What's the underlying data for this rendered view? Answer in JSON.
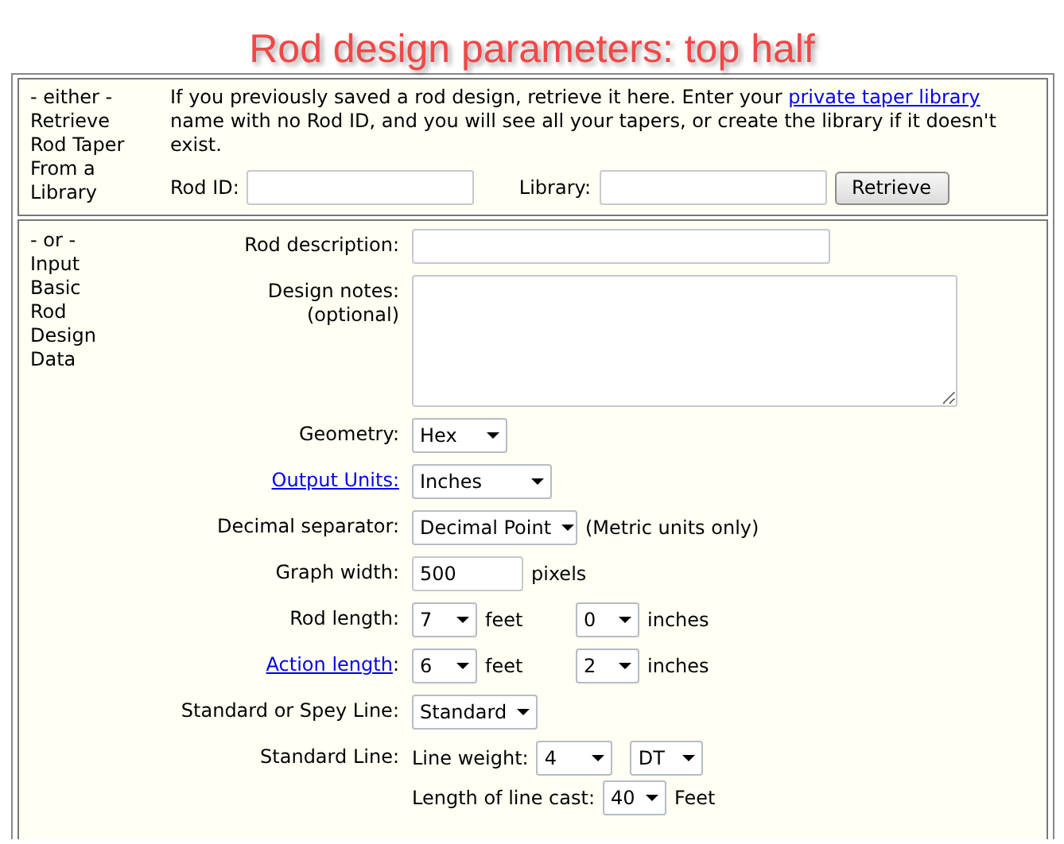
{
  "title": "Rod design parameters: top half",
  "retrieve": {
    "side_label": "- either -\nRetrieve\nRod Taper\nFrom a\nLibrary",
    "intro_before": "If you previously saved a rod design, retrieve it here. Enter your ",
    "intro_link": "private taper library",
    "intro_after": " name with no Rod ID, and you will see all your tapers, or create the library if it doesn't exist.",
    "rod_id_label": "Rod ID:",
    "library_label": "Library:",
    "button": "Retrieve"
  },
  "design": {
    "side_label": "- or -\nInput\nBasic\nRod\nDesign\nData",
    "rows": [
      {
        "label": "Rod description:",
        "link": false,
        "lines": [
          [
            {
              "kind": "input"
            }
          ]
        ]
      },
      {
        "label": "Design notes:\n(optional)",
        "link": false,
        "lines": [
          [
            {
              "kind": "textarea"
            }
          ]
        ]
      },
      {
        "label": "Geometry:",
        "link": false,
        "lines": [
          [
            {
              "kind": "select",
              "value": "Hex"
            }
          ]
        ]
      },
      {
        "label": "Output Units:",
        "link": true,
        "lines": [
          [
            {
              "kind": "select",
              "value": "Inches"
            }
          ]
        ]
      },
      {
        "label": "Decimal separator:",
        "link": false,
        "lines": [
          [
            {
              "kind": "select",
              "value": "Decimal Point"
            },
            {
              "kind": "text",
              "value": "(Metric units only)"
            }
          ]
        ]
      },
      {
        "label": "Graph width:",
        "link": false,
        "lines": [
          [
            {
              "kind": "input",
              "value": "500"
            },
            {
              "kind": "text",
              "value": "pixels"
            }
          ]
        ]
      },
      {
        "label": "Rod length:",
        "link": false,
        "lines": [
          [
            {
              "kind": "select",
              "value": "7"
            },
            {
              "kind": "text",
              "value": "feet"
            },
            {
              "kind": "select",
              "value": "0"
            },
            {
              "kind": "text",
              "value": "inches"
            }
          ]
        ]
      },
      {
        "label": "Action length",
        "link": true,
        "suffix": ":",
        "lines": [
          [
            {
              "kind": "select",
              "value": "6"
            },
            {
              "kind": "text",
              "value": "feet"
            },
            {
              "kind": "select",
              "value": "2"
            },
            {
              "kind": "text",
              "value": "inches"
            }
          ]
        ]
      },
      {
        "label": "Standard or Spey Line:",
        "link": false,
        "lines": [
          [
            {
              "kind": "select",
              "value": "Standard"
            }
          ]
        ]
      },
      {
        "label": "Standard Line:",
        "link": false,
        "lines": [
          [
            {
              "kind": "text",
              "value": "Line weight:"
            },
            {
              "kind": "select",
              "value": "4"
            },
            {
              "kind": "select",
              "value": "DT"
            }
          ],
          [
            {
              "kind": "text",
              "value": "Length of line cast:"
            },
            {
              "kind": "select",
              "value": "40"
            },
            {
              "kind": "text",
              "value": "Feet"
            }
          ]
        ]
      }
    ]
  }
}
